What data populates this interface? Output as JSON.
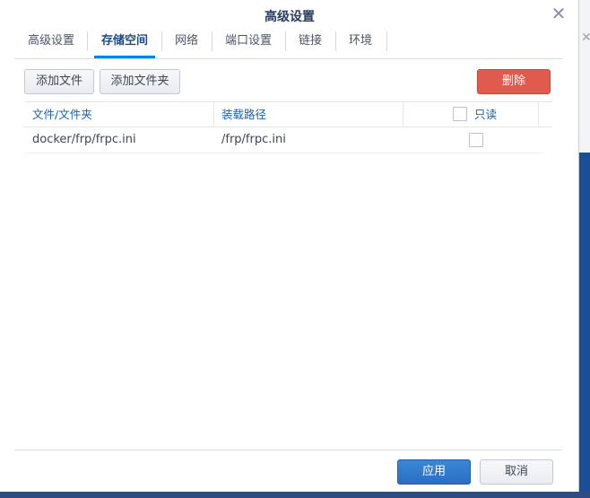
{
  "dialog": {
    "title": "高级设置"
  },
  "tabs": [
    {
      "label": "高级设置",
      "active": false
    },
    {
      "label": "存储空间",
      "active": true
    },
    {
      "label": "网络",
      "active": false
    },
    {
      "label": "端口设置",
      "active": false
    },
    {
      "label": "链接",
      "active": false
    },
    {
      "label": "环境",
      "active": false
    }
  ],
  "toolbar": {
    "add_file_label": "添加文件",
    "add_folder_label": "添加文件夹",
    "delete_label": "删除"
  },
  "table": {
    "columns": [
      "文件/文件夹",
      "装载路径",
      "只读"
    ],
    "rows": [
      {
        "file": "docker/frp/frpc.ini",
        "mount_path": "/frp/frpc.ini",
        "readonly": false
      }
    ]
  },
  "footer": {
    "apply_label": "应用",
    "cancel_label": "取消"
  },
  "icons": {
    "close": "close-icon"
  },
  "colors": {
    "accent": "#0086e5",
    "delete": "#e05a4e",
    "apply": "#2a6fc2",
    "header_text": "#1d5fa8"
  }
}
